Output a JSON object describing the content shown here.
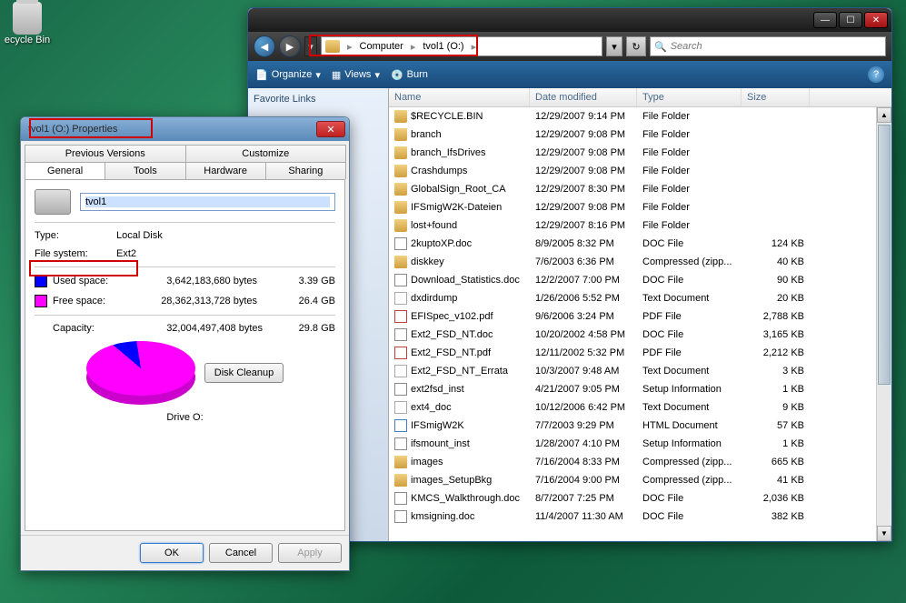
{
  "desktop": {
    "recycle": "ecycle Bin"
  },
  "explorer": {
    "breadcrumb": [
      "Computer",
      "tvol1 (O:)"
    ],
    "search_placeholder": "Search",
    "toolbar": {
      "organize": "Organize",
      "views": "Views",
      "burn": "Burn"
    },
    "sidebar": {
      "favlinks": "Favorite Links"
    },
    "columns": {
      "name": "Name",
      "date": "Date modified",
      "type": "Type",
      "size": "Size"
    },
    "files": [
      {
        "icon": "folder",
        "name": "$RECYCLE.BIN",
        "date": "12/29/2007 9:14 PM",
        "type": "File Folder",
        "size": ""
      },
      {
        "icon": "folder",
        "name": "branch",
        "date": "12/29/2007 9:08 PM",
        "type": "File Folder",
        "size": ""
      },
      {
        "icon": "folder",
        "name": "branch_IfsDrives",
        "date": "12/29/2007 9:08 PM",
        "type": "File Folder",
        "size": ""
      },
      {
        "icon": "folder",
        "name": "Crashdumps",
        "date": "12/29/2007 9:08 PM",
        "type": "File Folder",
        "size": ""
      },
      {
        "icon": "folder",
        "name": "GlobalSign_Root_CA",
        "date": "12/29/2007 8:30 PM",
        "type": "File Folder",
        "size": ""
      },
      {
        "icon": "folder",
        "name": "IFSmigW2K-Dateien",
        "date": "12/29/2007 9:08 PM",
        "type": "File Folder",
        "size": ""
      },
      {
        "icon": "folder",
        "name": "lost+found",
        "date": "12/29/2007 8:16 PM",
        "type": "File Folder",
        "size": ""
      },
      {
        "icon": "doc",
        "name": "2kuptoXP.doc",
        "date": "8/9/2005 8:32 PM",
        "type": "DOC File",
        "size": "124 KB"
      },
      {
        "icon": "zip",
        "name": "diskkey",
        "date": "7/6/2003 6:36 PM",
        "type": "Compressed (zipp...",
        "size": "40 KB"
      },
      {
        "icon": "doc",
        "name": "Download_Statistics.doc",
        "date": "12/2/2007 7:00 PM",
        "type": "DOC File",
        "size": "90 KB"
      },
      {
        "icon": "txt",
        "name": "dxdirdump",
        "date": "1/26/2006 5:52 PM",
        "type": "Text Document",
        "size": "20 KB"
      },
      {
        "icon": "pdf",
        "name": "EFISpec_v102.pdf",
        "date": "9/6/2006 3:24 PM",
        "type": "PDF File",
        "size": "2,788 KB"
      },
      {
        "icon": "doc",
        "name": "Ext2_FSD_NT.doc",
        "date": "10/20/2002 4:58 PM",
        "type": "DOC File",
        "size": "3,165 KB"
      },
      {
        "icon": "pdf",
        "name": "Ext2_FSD_NT.pdf",
        "date": "12/11/2002 5:32 PM",
        "type": "PDF File",
        "size": "2,212 KB"
      },
      {
        "icon": "txt",
        "name": "Ext2_FSD_NT_Errata",
        "date": "10/3/2007 9:48 AM",
        "type": "Text Document",
        "size": "3 KB"
      },
      {
        "icon": "inf",
        "name": "ext2fsd_inst",
        "date": "4/21/2007 9:05 PM",
        "type": "Setup Information",
        "size": "1 KB"
      },
      {
        "icon": "txt",
        "name": "ext4_doc",
        "date": "10/12/2006 6:42 PM",
        "type": "Text Document",
        "size": "9 KB"
      },
      {
        "icon": "html",
        "name": "IFSmigW2K",
        "date": "7/7/2003 9:29 PM",
        "type": "HTML Document",
        "size": "57 KB"
      },
      {
        "icon": "inf",
        "name": "ifsmount_inst",
        "date": "1/28/2007 4:10 PM",
        "type": "Setup Information",
        "size": "1 KB"
      },
      {
        "icon": "zip",
        "name": "images",
        "date": "7/16/2004 8:33 PM",
        "type": "Compressed (zipp...",
        "size": "665 KB"
      },
      {
        "icon": "zip",
        "name": "images_SetupBkg",
        "date": "7/16/2004 9:00 PM",
        "type": "Compressed (zipp...",
        "size": "41 KB"
      },
      {
        "icon": "doc",
        "name": "KMCS_Walkthrough.doc",
        "date": "8/7/2007 7:25 PM",
        "type": "DOC File",
        "size": "2,036 KB"
      },
      {
        "icon": "doc",
        "name": "kmsigning.doc",
        "date": "11/4/2007 11:30 AM",
        "type": "DOC File",
        "size": "382 KB"
      }
    ]
  },
  "props": {
    "title": "tvol1 (O:) Properties",
    "tabs_top": [
      "Previous Versions",
      "Customize"
    ],
    "tabs_bottom": [
      "General",
      "Tools",
      "Hardware",
      "Sharing"
    ],
    "drivename": "tvol1",
    "type_label": "Type:",
    "type_value": "Local Disk",
    "fs_label": "File system:",
    "fs_value": "Ext2",
    "used_label": "Used space:",
    "used_bytes": "3,642,183,680 bytes",
    "used_size": "3.39 GB",
    "free_label": "Free space:",
    "free_bytes": "28,362,313,728 bytes",
    "free_size": "26.4 GB",
    "cap_label": "Capacity:",
    "cap_bytes": "32,004,497,408 bytes",
    "cap_size": "29.8 GB",
    "drive_caption": "Drive O:",
    "cleanup": "Disk Cleanup",
    "ok": "OK",
    "cancel": "Cancel",
    "apply": "Apply"
  },
  "chart_data": {
    "type": "pie",
    "title": "Drive O:",
    "series": [
      {
        "name": "Used space",
        "value": 3642183680,
        "display": "3.39 GB",
        "color": "#0000ff"
      },
      {
        "name": "Free space",
        "value": 28362313728,
        "display": "26.4 GB",
        "color": "#ff00ff"
      }
    ],
    "total": 32004497408,
    "total_display": "29.8 GB"
  }
}
